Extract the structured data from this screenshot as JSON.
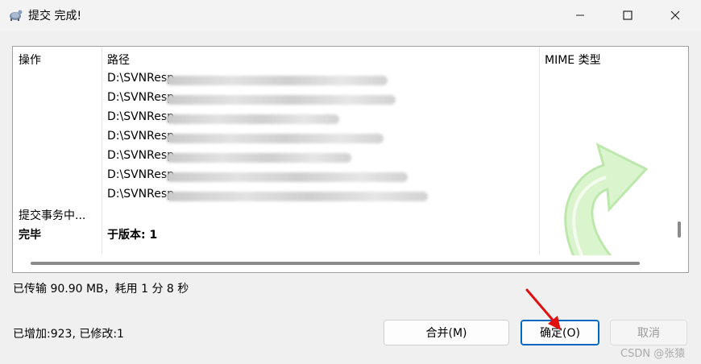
{
  "window": {
    "title": "提交 完成!"
  },
  "titlebar_icons": {
    "minimize": "minimize-icon",
    "maximize": "maximize-icon",
    "close": "close-icon",
    "app": "tortoise-svn-icon"
  },
  "table": {
    "headers": {
      "action": "操作",
      "path": "路径",
      "mime": "MIME 类型"
    },
    "paths": [
      "D:\\SVNResp",
      "D:\\SVNResp",
      "D:\\SVNResp",
      "D:\\SVNResp",
      "D:\\SVNResp",
      "D:\\SVNResp",
      "D:\\SVNResp"
    ],
    "transaction_row": {
      "action": "提交事务中..."
    },
    "done_row": {
      "action": "完毕",
      "path": "于版本: 1"
    }
  },
  "status": {
    "transfer": "已传输 90.90 MB，耗用 1 分 8 秒",
    "changes": "已增加:923, 已修改:1"
  },
  "buttons": {
    "merge": "合并(M)",
    "ok": "确定(O)",
    "cancel": "取消"
  },
  "watermark": "CSDN @张猿",
  "colors": {
    "ok_border": "#0067c0",
    "annotation_arrow": "#e01010",
    "decor_arrow": "#c8f0b8"
  }
}
